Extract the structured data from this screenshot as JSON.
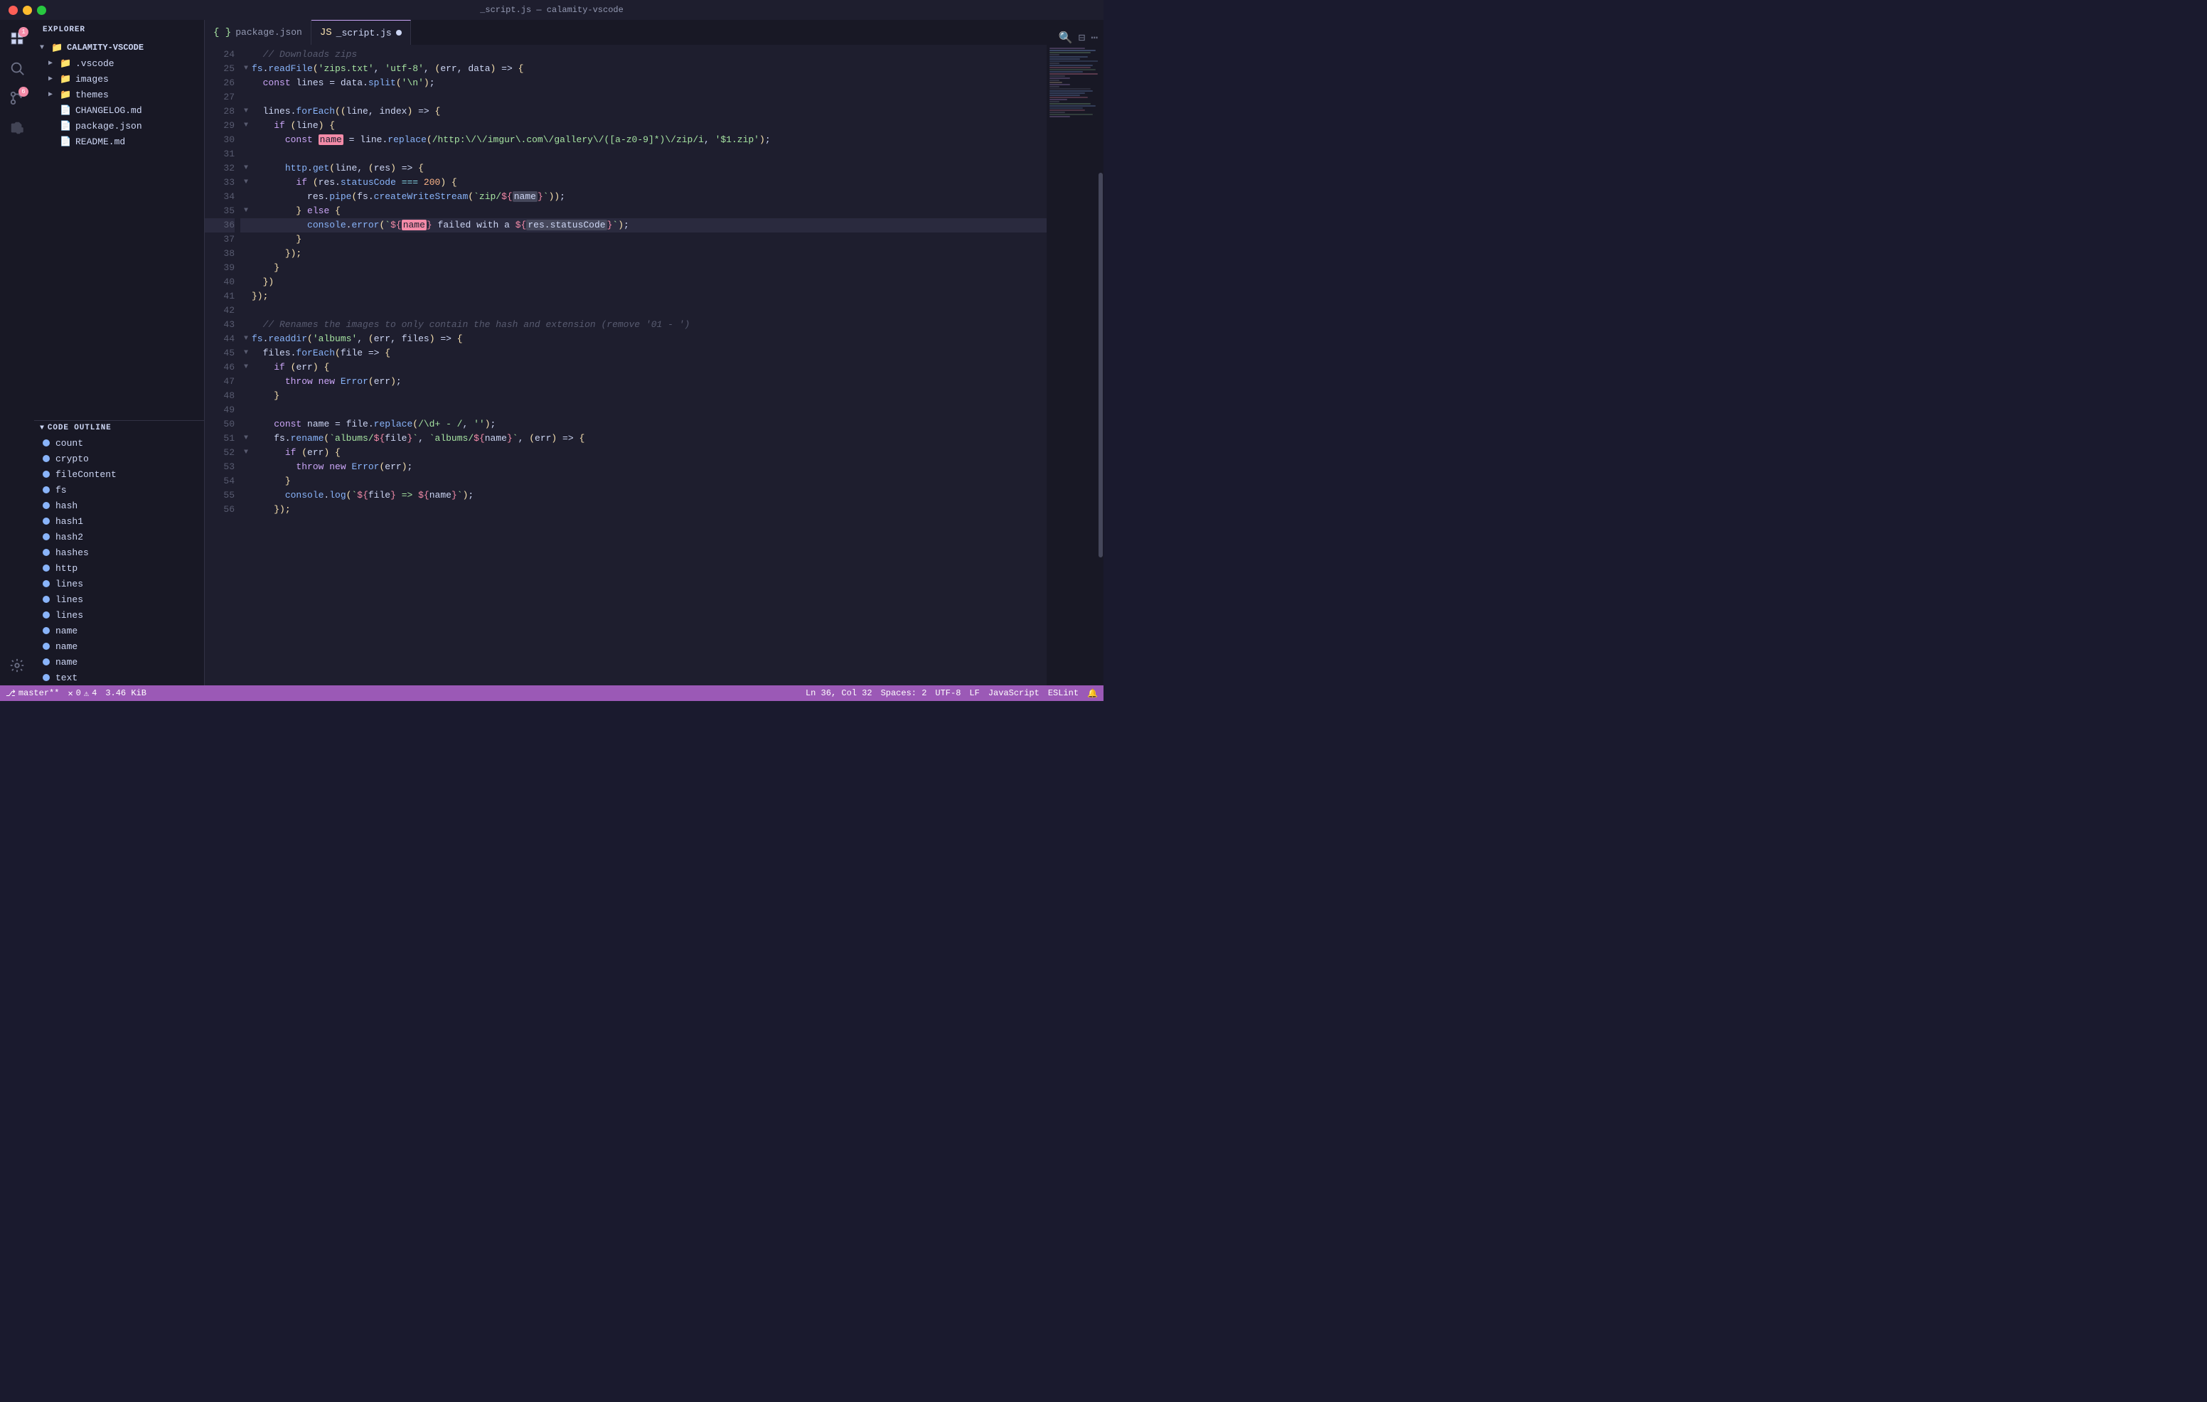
{
  "titlebar": {
    "title": "_script.js — calamity-vscode"
  },
  "sidebar": {
    "title": "EXPLORER",
    "root": "CALAMITY-VSCODE",
    "tree": [
      {
        "id": "vscode",
        "label": ".vscode",
        "type": "folder",
        "indent": 1,
        "expanded": false
      },
      {
        "id": "images",
        "label": "images",
        "type": "folder",
        "indent": 1,
        "expanded": false
      },
      {
        "id": "themes",
        "label": "themes",
        "type": "folder",
        "indent": 1,
        "expanded": false
      },
      {
        "id": "changelog",
        "label": "CHANGELOG.md",
        "type": "md",
        "indent": 1
      },
      {
        "id": "packagejson",
        "label": "package.json",
        "type": "json",
        "indent": 1
      },
      {
        "id": "readme",
        "label": "README.md",
        "type": "md",
        "indent": 1
      }
    ]
  },
  "outline": {
    "title": "CODE OUTLINE",
    "items": [
      {
        "id": "count",
        "label": "count"
      },
      {
        "id": "crypto",
        "label": "crypto"
      },
      {
        "id": "fileContent",
        "label": "fileContent"
      },
      {
        "id": "fs",
        "label": "fs"
      },
      {
        "id": "hash",
        "label": "hash"
      },
      {
        "id": "hash1",
        "label": "hash1"
      },
      {
        "id": "hash2",
        "label": "hash2"
      },
      {
        "id": "hashes",
        "label": "hashes"
      },
      {
        "id": "http",
        "label": "http"
      },
      {
        "id": "lines",
        "label": "lines"
      },
      {
        "id": "lines2",
        "label": "lines"
      },
      {
        "id": "lines3",
        "label": "lines"
      },
      {
        "id": "name",
        "label": "name"
      },
      {
        "id": "name2",
        "label": "name"
      },
      {
        "id": "name3",
        "label": "name"
      },
      {
        "id": "text",
        "label": "text"
      }
    ]
  },
  "tabs": [
    {
      "id": "packagejson",
      "label": "package.json",
      "active": false,
      "modified": false,
      "icon": "json"
    },
    {
      "id": "script",
      "label": "_script.js",
      "active": true,
      "modified": true,
      "icon": "js"
    }
  ],
  "code": {
    "lines": [
      {
        "num": 24,
        "fold": false,
        "content": "  // Downloads zips"
      },
      {
        "num": 25,
        "fold": true,
        "content": "fs.readFile('zips.txt', 'utf-8', (err, data) => {"
      },
      {
        "num": 26,
        "fold": false,
        "content": "  const lines = data.split('\\n');"
      },
      {
        "num": 27,
        "fold": false,
        "content": ""
      },
      {
        "num": 28,
        "fold": true,
        "content": "  lines.forEach((line, index) => {"
      },
      {
        "num": 29,
        "fold": true,
        "content": "    if (line) {"
      },
      {
        "num": 30,
        "fold": false,
        "content": "      const name = line.replace(/http:\\/\\/imgur\\.com\\/gallery\\/([a-z0-9]*)\\/zip/i, '$1.zip');"
      },
      {
        "num": 31,
        "fold": false,
        "content": ""
      },
      {
        "num": 32,
        "fold": true,
        "content": "      http.get(line, (res) => {"
      },
      {
        "num": 33,
        "fold": true,
        "content": "        if (res.statusCode === 200) {"
      },
      {
        "num": 34,
        "fold": false,
        "content": "          res.pipe(fs.createWriteStream(`zip/${name}`));"
      },
      {
        "num": 35,
        "fold": true,
        "content": "        } else {"
      },
      {
        "num": 36,
        "fold": false,
        "content": "          console.error(`${name} failed with a ${res.statusCode}`);"
      },
      {
        "num": 37,
        "fold": false,
        "content": "        }"
      },
      {
        "num": 38,
        "fold": false,
        "content": "      });"
      },
      {
        "num": 39,
        "fold": false,
        "content": "    }"
      },
      {
        "num": 40,
        "fold": false,
        "content": "  })"
      },
      {
        "num": 41,
        "fold": false,
        "content": "});"
      },
      {
        "num": 42,
        "fold": false,
        "content": ""
      },
      {
        "num": 43,
        "fold": false,
        "content": "  // Renames the images to only contain the hash and extension (remove '01 - ')"
      },
      {
        "num": 44,
        "fold": true,
        "content": "fs.readdir('albums', (err, files) => {"
      },
      {
        "num": 45,
        "fold": true,
        "content": "  files.forEach(file => {"
      },
      {
        "num": 46,
        "fold": true,
        "content": "    if (err) {"
      },
      {
        "num": 47,
        "fold": false,
        "content": "      throw new Error(err);"
      },
      {
        "num": 48,
        "fold": false,
        "content": "    }"
      },
      {
        "num": 49,
        "fold": false,
        "content": ""
      },
      {
        "num": 50,
        "fold": false,
        "content": "    const name = file.replace(/\\d+ - /, '');"
      },
      {
        "num": 51,
        "fold": true,
        "content": "    fs.rename(`albums/${file}`, `albums/${name}`, (err) => {"
      },
      {
        "num": 52,
        "fold": true,
        "content": "      if (err) {"
      },
      {
        "num": 53,
        "fold": false,
        "content": "        throw new Error(err);"
      },
      {
        "num": 54,
        "fold": false,
        "content": "      }"
      },
      {
        "num": 55,
        "fold": false,
        "content": "      console.log(`${file} => ${name}`);"
      },
      {
        "num": 56,
        "fold": false,
        "content": "    });"
      }
    ]
  },
  "status": {
    "branch": "master**",
    "errors": "0",
    "warnings": "4",
    "size": "3.46 KiB",
    "position": "Ln 36, Col 32",
    "spaces": "Spaces: 2",
    "encoding": "UTF-8",
    "eol": "LF",
    "language": "JavaScript",
    "linter": "ESLint"
  }
}
